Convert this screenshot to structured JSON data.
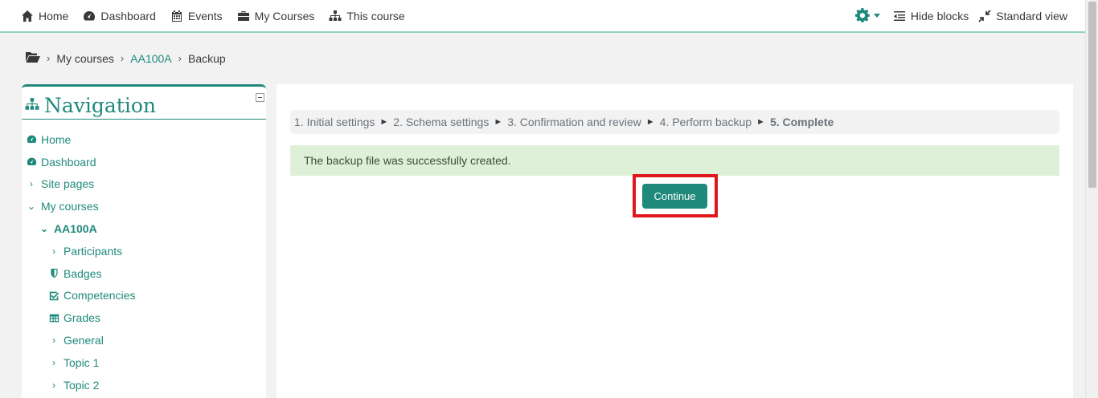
{
  "topnav": {
    "items": [
      {
        "label": "Home",
        "icon": "home-icon"
      },
      {
        "label": "Dashboard",
        "icon": "dashboard-icon"
      },
      {
        "label": "Events",
        "icon": "calendar-icon"
      },
      {
        "label": "My Courses",
        "icon": "briefcase-icon"
      },
      {
        "label": "This course",
        "icon": "sitemap-icon"
      }
    ],
    "hide_blocks": "Hide blocks",
    "standard_view": "Standard view"
  },
  "breadcrumb": {
    "items": [
      "My courses",
      "AA100A",
      "Backup"
    ]
  },
  "navigation": {
    "title": "Navigation",
    "items": [
      {
        "label": "Home"
      },
      {
        "label": "Dashboard"
      },
      {
        "label": "Site pages"
      },
      {
        "label": "My courses"
      },
      {
        "label": "AA100A"
      },
      {
        "label": "Participants"
      },
      {
        "label": "Badges"
      },
      {
        "label": "Competencies"
      },
      {
        "label": "Grades"
      },
      {
        "label": "General"
      },
      {
        "label": "Topic 1"
      },
      {
        "label": "Topic 2"
      }
    ]
  },
  "progress": {
    "steps": [
      "1. Initial settings",
      "2. Schema settings",
      "3. Confirmation and review",
      "4. Perform backup",
      "5. Complete"
    ],
    "separator": "►"
  },
  "alert": {
    "message": "The backup file was successfully created."
  },
  "actions": {
    "continue_label": "Continue"
  },
  "colors": {
    "accent": "#1f8a7b",
    "success_bg": "#dff0d8",
    "highlight": "#e0161c"
  }
}
